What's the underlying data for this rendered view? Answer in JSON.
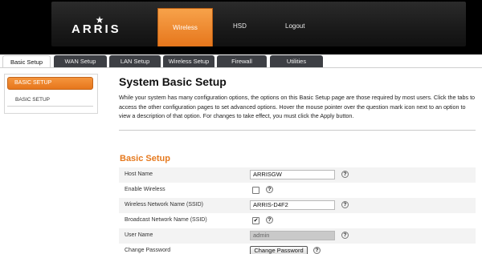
{
  "brand": {
    "logo_text": "ARRIS"
  },
  "top_nav": {
    "items": [
      "Wireless",
      "HSD",
      "Logout"
    ]
  },
  "tabs": [
    "Basic Setup",
    "WAN Setup",
    "LAN Setup",
    "Wireless Setup",
    "Firewall",
    "Utilities"
  ],
  "sidebar": {
    "active": "BASIC SETUP",
    "items": [
      "BASIC SETUP"
    ]
  },
  "main": {
    "title": "System Basic Setup",
    "description": "While your system has many configuration options, the options on this Basic Setup page are those required by most users. Click the tabs to access the other configuration pages to set advanced options. Hover the mouse pointer over the question mark icon next to an option to view a description of that option. For changes to take effect, you must click the Apply button.",
    "section_title": "Basic Setup",
    "help_glyph": "?",
    "check_glyph": "✔",
    "rows": {
      "host_name": {
        "label": "Host Name",
        "value": "ARRISGW"
      },
      "enable_wireless": {
        "label": "Enable Wireless",
        "checked": false
      },
      "ssid": {
        "label": "Wireless Network Name (SSID)",
        "value": "ARRIS-D4F2"
      },
      "broadcast_ssid": {
        "label": "Broadcast Network Name (SSID)",
        "checked": true
      },
      "user_name": {
        "label": "User Name",
        "value": "admin"
      },
      "change_password": {
        "label": "Change Password",
        "button": "Change Password"
      }
    }
  },
  "colors": {
    "accent": "#e67a1f",
    "header": "#000000",
    "tab": "#3d3f44"
  }
}
